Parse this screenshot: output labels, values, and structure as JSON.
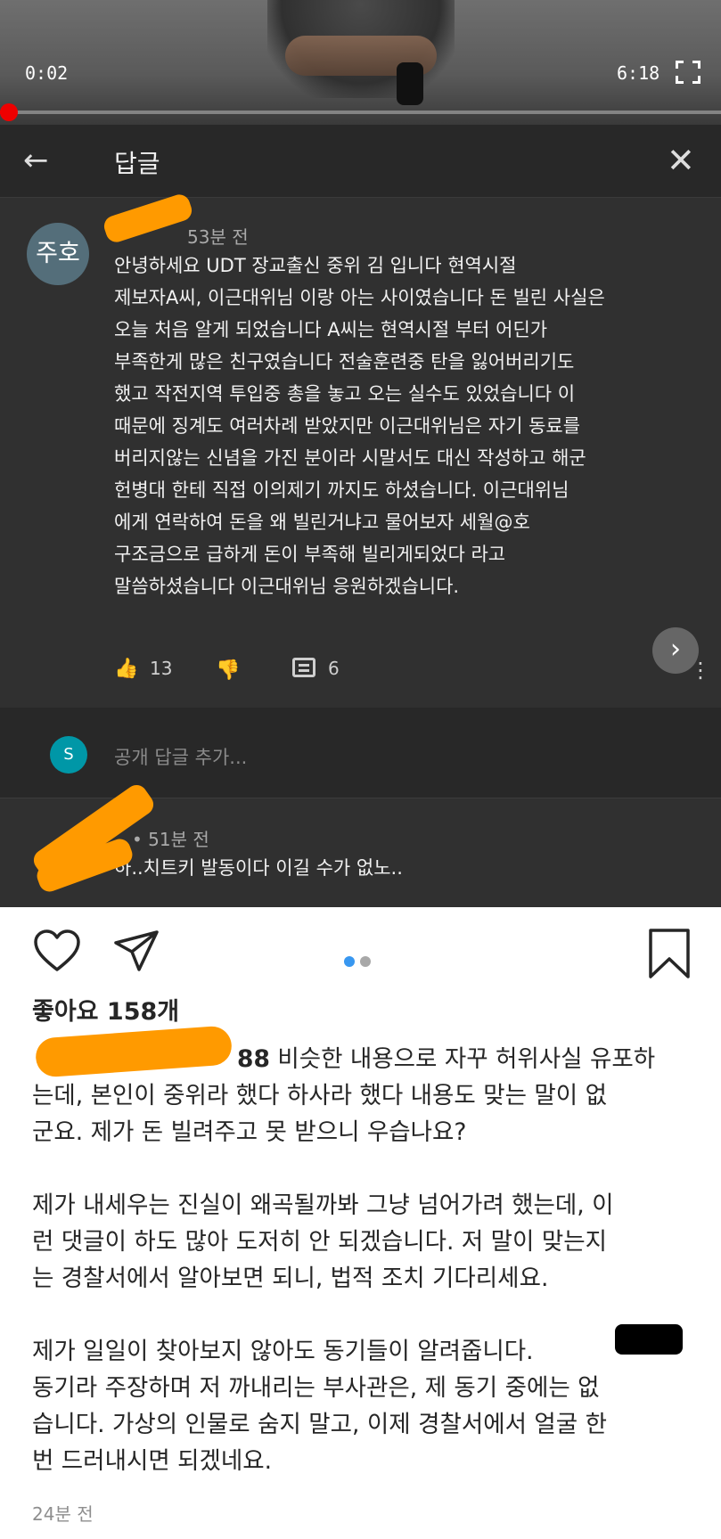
{
  "video": {
    "current_time": "0:02",
    "duration": "6:18",
    "progress_fraction": 0.005
  },
  "reply_panel": {
    "title": "답글",
    "comment": {
      "avatar_text": "주호",
      "time_ago": "53분 전",
      "lines": [
        "안녕하세요 UDT 장교출신 중위 김 입니다 현역시절",
        "제보자A씨, 이근대위님 이랑 아는 사이였습니다 돈 빌린 사실은",
        "오늘 처음 알게 되었습니다 A씨는 현역시절 부터 어딘가",
        "부족한게 많은 친구였습니다 전술훈련중 탄을 잃어버리기도",
        "했고 작전지역 투입중  총을 놓고 오는 실수도 있었습니다 이",
        "때문에 징계도 여러차례 받았지만 이근대위님은 자기 동료를",
        "버리지않는 신념을 가진 분이라 시말서도 대신 작성하고 해군",
        "헌병대 한테 직접 이의제기 까지도 하셨습니다. 이근대위님",
        "에게 연락하여 돈을 왜 빌린거냐고 물어보자 세월@호",
        "구조금으로 급하게 돈이 부족해 빌리게되었다 라고",
        "말씀하셨습니다 이근대위님 응원하겠습니다."
      ],
      "likes": "13",
      "replies": "6"
    },
    "add_reply": {
      "avatar_text": "S",
      "placeholder": "공개 답글 추가..."
    },
    "reply": {
      "time_ago": "• 51분 전",
      "text": "하..치트키 발동이다 이길 수가 없노.."
    }
  },
  "post": {
    "likes_label": "좋아요 158개",
    "caption": {
      "username_fragment": "88",
      "first_line_rest": " 비슷한 내용으로 자꾸 허위사실 유포하",
      "lines_p1": [
        "는데, 본인이 중위라 했다 하사라 했다 내용도 맞는 말이 없",
        "군요. 제가 돈 빌려주고 못 받으니 우습나요?"
      ],
      "lines_p2": [
        "제가 내세우는 진실이 왜곡될까봐 그냥 넘어가려 했는데, 이",
        "런 댓글이 하도 많아 도저히 안 되겠습니다. 저 말이 맞는지",
        "는 경찰서에서 알아보면 되니, 법적 조치 기다리세요."
      ],
      "lines_p3": [
        "제가 일일이 찾아보지 않아도 동기들이 알려줍니다.",
        "동기라 주장하며 저 까내리는 부사관은, 제 동기 중에는 없",
        "습니다. 가상의 인물로 숨지 말고, 이제 경찰서에서 얼굴 한",
        "번 드러내시면 되겠네요."
      ]
    },
    "timestamp": "24분 전"
  },
  "colors": {
    "panel_bg": "#303030",
    "redaction": "#ff9a00",
    "progress": "#e00000",
    "carousel_active": "#3897f0"
  }
}
